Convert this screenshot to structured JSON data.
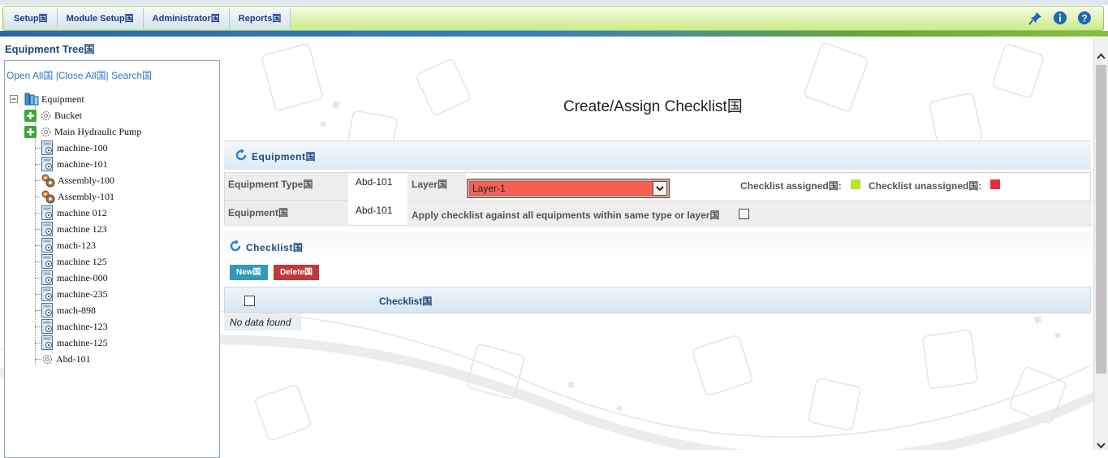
{
  "nav": {
    "items": [
      "Setup国",
      "Module Setup国",
      "Administrator国",
      "Reports国"
    ],
    "icons": [
      "pin-icon",
      "info-icon",
      "help-icon"
    ]
  },
  "tree": {
    "title": "Equipment Tree国",
    "open_all": "Open All国",
    "close_all": "Close All国",
    "search": "Search国",
    "root": "Equipment",
    "nodes": [
      "Bucket",
      "Main Hydraulic Pump",
      "machine-100",
      "machine-101",
      "Assembly-100",
      "Assembly-101",
      "machine 012",
      "machine 123",
      "mach-123",
      "machine 125",
      "machine-000",
      "machine-235",
      "mach-898",
      "machine-123",
      "machine-125",
      "Abd-101"
    ]
  },
  "page": {
    "title": "Create/Assign Checklist国"
  },
  "equipment": {
    "section_title": "Equipment国",
    "type_label": "Equipment Type国",
    "type_value": "Abd-101",
    "layer_label": "Layer国",
    "layer_value": "Layer-1",
    "assigned_label": "Checklist assigned国:",
    "unassigned_label": "Checklist unassigned国:",
    "assigned_color": "#b5e62a",
    "unassigned_color": "#ee2a36",
    "equipment_label": "Equipment国",
    "equipment_value": "Abd-101",
    "apply_label": "Apply checklist against all equipments within same type or layer国"
  },
  "checklist": {
    "section_title": "Checklist国",
    "new_label": "New国",
    "delete_label": "Delete国",
    "column_header": "Checklist国",
    "empty_text": "No data found"
  }
}
